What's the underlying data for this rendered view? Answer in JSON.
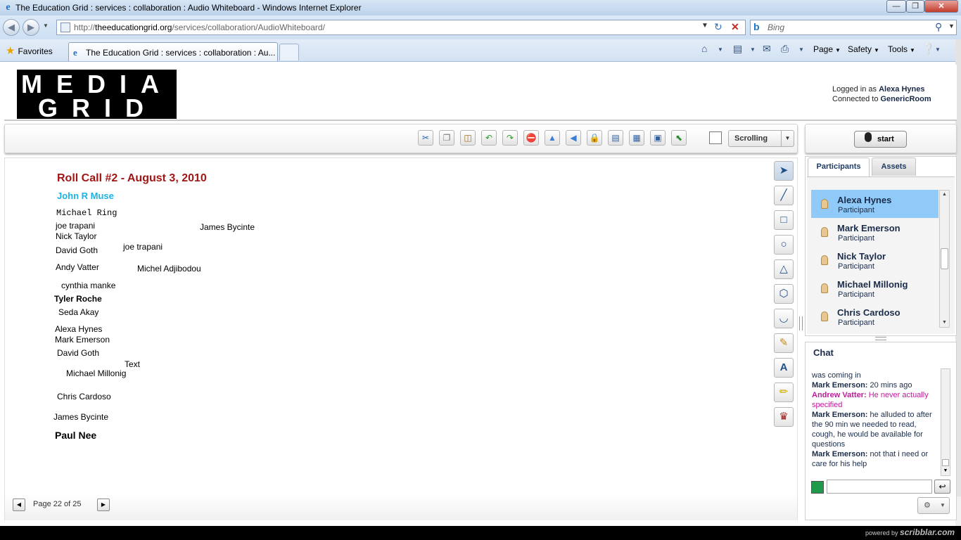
{
  "window": {
    "title": "The Education Grid : services : collaboration : Audio Whiteboard - Windows Internet Explorer",
    "min_icon": "minimize-icon",
    "max_icon": "maximize-icon",
    "close_icon": "close-icon"
  },
  "addressbar": {
    "url_prefix": "http://",
    "url_domain": "theeducationgrid.org",
    "url_path": "/services/collaboration/AudioWhiteboard/",
    "search_placeholder": "Bing"
  },
  "favbar": {
    "favorites_label": "Favorites",
    "tab_title": "The Education Grid : services : collaboration : Au...",
    "page_label": "Page",
    "safety_label": "Safety",
    "tools_label": "Tools"
  },
  "header": {
    "logo_line1": "MEDIA",
    "logo_line2": "GRID",
    "logged_in_prefix": "Logged in as",
    "logged_in_user": "Alexa Hynes",
    "connected_prefix": "Connected to",
    "connected_room": "GenericRoom"
  },
  "toolbar": {
    "mode_value": "Scrolling",
    "audio_button": "start"
  },
  "whiteboard": {
    "title": "Roll Call #2 - August 3, 2010",
    "subtitle": "John R Muse",
    "entries": [
      "Michael Ring",
      "joe trapani",
      "Nick Taylor",
      "James Bycinte",
      "David Goth",
      "joe trapani",
      "Andy Vatter",
      "Michel Adjibodou",
      "cynthia manke",
      "Tyler Roche",
      "Seda Akay",
      "Alexa Hynes",
      "Mark Emerson",
      "David Goth",
      "Text",
      "Michael Millonig",
      "Chris Cardoso",
      "James Bycinte",
      "Paul Nee"
    ],
    "page_indicator": "Page 22 of 25"
  },
  "participants": {
    "tab_participants": "Participants",
    "tab_assets": "Assets",
    "list": [
      {
        "name": "Alexa Hynes",
        "role": "Participant"
      },
      {
        "name": "Mark Emerson",
        "role": "Participant"
      },
      {
        "name": "Nick Taylor",
        "role": "Participant"
      },
      {
        "name": "Michael Millonig",
        "role": "Participant"
      },
      {
        "name": "Chris Cardoso",
        "role": "Participant"
      }
    ]
  },
  "chat": {
    "title": "Chat",
    "messages": [
      {
        "author": "",
        "text": "was coming in"
      },
      {
        "author": "Mark Emerson:",
        "text": "20 mins ago"
      },
      {
        "author": "Andrew Vatter:",
        "text": "He never actually specified"
      },
      {
        "author": "Mark Emerson:",
        "text": "he alluded to after the 90 min we needed to read, cough, he would be available for questions"
      },
      {
        "author": "Mark Emerson:",
        "text": "not that i need or care for his help"
      }
    ],
    "input_value": ""
  },
  "footer": {
    "powered_prefix": "powered by",
    "powered_brand": "scribblar.com"
  },
  "colors": {
    "whiteboard_title": "#a31515",
    "whiteboard_subtitle": "#1ab3e6",
    "chat_highlight": "#c2189a",
    "selected_participant": "#8fcaf8",
    "chat_color_swatch": "#1f9a4a"
  }
}
